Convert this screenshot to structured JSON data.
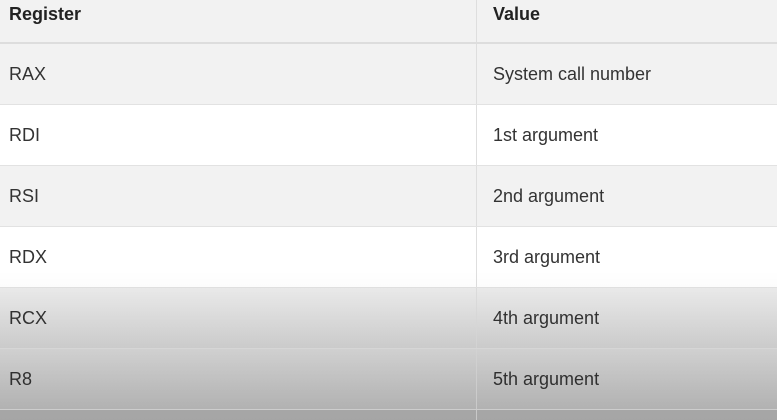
{
  "table": {
    "headers": [
      "Register",
      "Value"
    ],
    "rows": [
      [
        "RAX",
        "System call number"
      ],
      [
        "RDI",
        "1st argument"
      ],
      [
        "RSI",
        "2nd argument"
      ],
      [
        "RDX",
        "3rd argument"
      ],
      [
        "RCX",
        "4th argument"
      ],
      [
        "R8",
        "5th argument"
      ]
    ]
  }
}
